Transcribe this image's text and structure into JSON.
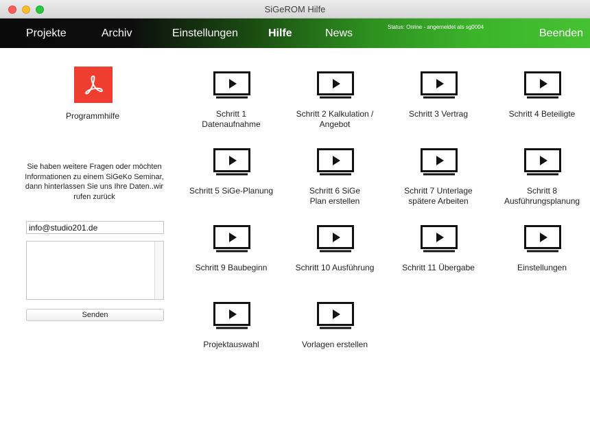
{
  "window": {
    "title": "SiGeROM   Hilfe"
  },
  "nav": {
    "items": [
      "Projekte",
      "Archiv",
      "Einstellungen",
      "Hilfe",
      "News"
    ],
    "active": "Hilfe",
    "status": "Status: Online - angemeldet als sg0004",
    "quit": "Beenden"
  },
  "sidebar": {
    "help_label": "Programmhilfe",
    "info_text": "Sie haben weitere Fragen oder möchten Informationen zu einem SiGeKo Seminar, dann hinterlassen Sie uns Ihre Daten..wir rufen zurück",
    "email_value": "info@studio201.de",
    "message_value": "",
    "send_label": "Senden"
  },
  "videos": [
    [
      "Schritt 1",
      "Datenaufnahme"
    ],
    [
      "Schritt 2 Kalkulation /",
      "Angebot"
    ],
    [
      "Schritt 3 Vertrag"
    ],
    [
      "Schritt 4 Beteiligte"
    ],
    [
      "Schritt 5 SiGe-Planung"
    ],
    [
      "Schritt 6 SiGe",
      "Plan erstellen"
    ],
    [
      "Schritt 7 Unterlage",
      "spätere Arbeiten"
    ],
    [
      "Schritt 8",
      "Ausführungsplanung"
    ],
    [
      "Schritt 9 Baubeginn"
    ],
    [
      "Schritt 10 Ausführung"
    ],
    [
      "Schritt 11 Übergabe"
    ],
    [
      "Einstellungen"
    ],
    [
      "Projektauswahl"
    ],
    [
      "Vorlagen erstellen"
    ]
  ]
}
